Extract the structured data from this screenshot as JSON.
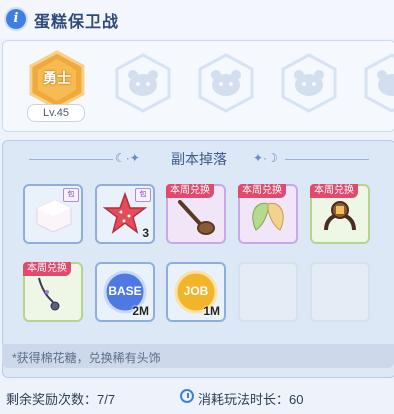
{
  "header": {
    "title": "蛋糕保卫战",
    "info_icon": "info-icon"
  },
  "hero": {
    "unlocked_label": "勇士",
    "level": "Lv.45",
    "locked_slots": 4,
    "colors": {
      "unlocked": "#f2a93b",
      "locked": "#c9d7ee"
    }
  },
  "drops": {
    "title": "副本掉落",
    "items": [
      {
        "name": "marshmallow",
        "tag": "",
        "qty": "",
        "pack": "包"
      },
      {
        "name": "red-star",
        "tag": "",
        "qty": "3",
        "pack": "包"
      },
      {
        "name": "pipe",
        "tag": "本周兑换",
        "qty": ""
      },
      {
        "name": "fairy-wings",
        "tag": "本周兑换",
        "qty": ""
      },
      {
        "name": "horn-headband",
        "tag": "本周兑换",
        "qty": ""
      },
      {
        "name": "necklace",
        "tag": "本周兑换",
        "qty": ""
      },
      {
        "name": "base-exp",
        "label": "BASE",
        "tag": "",
        "qty": "2M"
      },
      {
        "name": "job-exp",
        "label": "JOB",
        "tag": "",
        "qty": "1M"
      }
    ],
    "hint": "*获得棉花糖，兑换稀有头饰"
  },
  "footer": {
    "rewards_label": "剩余奖励次数：7/7",
    "duration_label": "消耗玩法时长：60"
  }
}
